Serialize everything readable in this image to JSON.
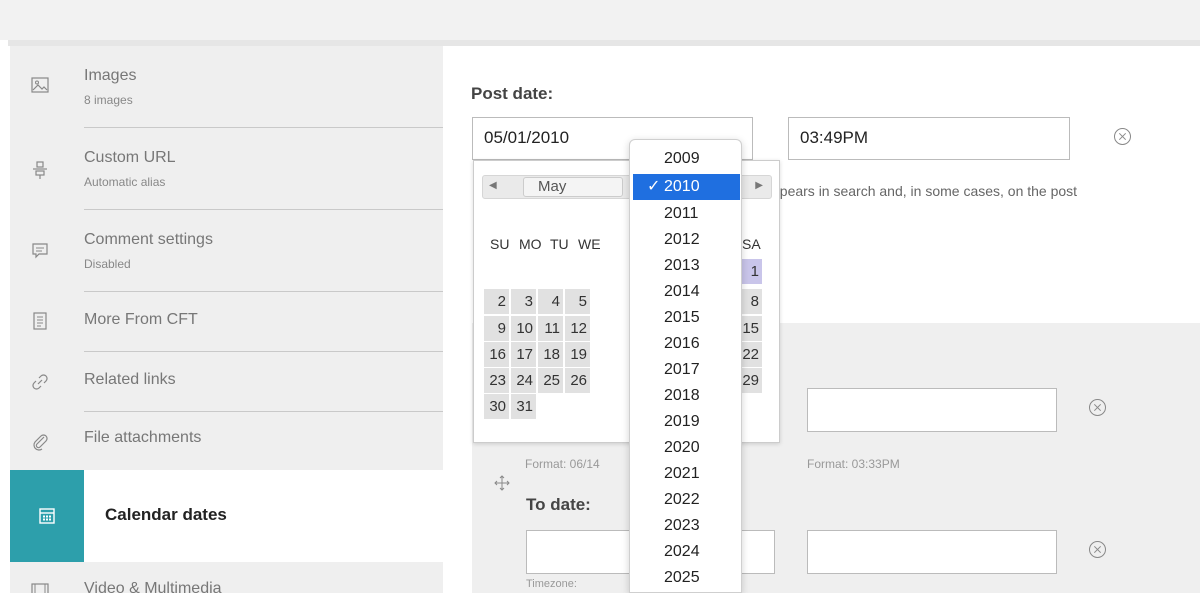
{
  "sidebar": {
    "items": [
      {
        "icon": "image-icon",
        "label": "Images",
        "sub": "8 images"
      },
      {
        "icon": "custom-url-icon",
        "label": "Custom URL",
        "sub": "Automatic alias"
      },
      {
        "icon": "comment-icon",
        "label": "Comment settings",
        "sub": "Disabled"
      },
      {
        "icon": "document-icon",
        "label": "More From CFT"
      },
      {
        "icon": "link-icon",
        "label": "Related links"
      },
      {
        "icon": "paperclip-icon",
        "label": "File attachments"
      },
      {
        "icon": "calendar-icon",
        "label": "Calendar dates",
        "active": true
      },
      {
        "icon": "film-icon",
        "label": "Video & Multimedia"
      }
    ]
  },
  "post_date": {
    "title": "Post date:",
    "date_value": "05/01/2010",
    "time_value": "03:49PM",
    "help_text": "ppears in search and, in some cases, on the post"
  },
  "calendar": {
    "month": "May",
    "weekdays": [
      "SU",
      "MO",
      "TU",
      "WE",
      "SA"
    ],
    "weeks": [
      [
        "",
        "",
        "",
        "",
        "1"
      ],
      [
        "2",
        "3",
        "4",
        "5",
        "8"
      ],
      [
        "9",
        "10",
        "11",
        "12",
        "15"
      ],
      [
        "16",
        "17",
        "18",
        "19",
        "22"
      ],
      [
        "23",
        "24",
        "25",
        "26",
        "29"
      ],
      [
        "30",
        "31",
        "",
        "",
        ""
      ]
    ],
    "selected_day": "1"
  },
  "year_dropdown": {
    "years": [
      "2009",
      "2010",
      "2011",
      "2012",
      "2013",
      "2014",
      "2015",
      "2016",
      "2017",
      "2018",
      "2019",
      "2020",
      "2021",
      "2022",
      "2023",
      "2024",
      "2025"
    ],
    "selected": "2010",
    "check": "✓"
  },
  "from_date": {
    "date_format": "Format: 06/14",
    "time_format": "Format: 03:33PM"
  },
  "to_date": {
    "title": "To date:",
    "timezone_label": "Timezone:"
  },
  "colors": {
    "accent": "#2d9fab",
    "dropdown_highlight": "#1f6fe0",
    "selected_day": "#c9c5ea"
  }
}
